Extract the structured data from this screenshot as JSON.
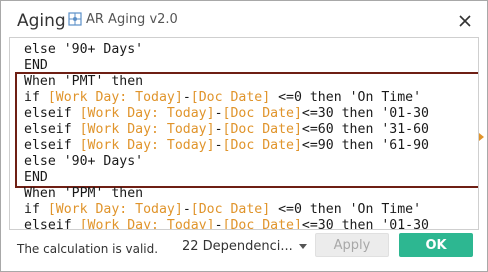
{
  "dialog": {
    "title": "Aging",
    "datasource_icon": "datasource-icon",
    "datasource_label": "AR Aging v2.0",
    "close_icon": "close-icon"
  },
  "code": {
    "lines": [
      [
        {
          "t": "else '90+ Days'",
          "c": "kw"
        }
      ],
      [
        {
          "t": "END",
          "c": "kw"
        }
      ],
      [
        {
          "t": "When 'PMT' then",
          "c": "kw"
        }
      ],
      [
        {
          "t": "if ",
          "c": "kw"
        },
        {
          "t": "[Work Day: Today]",
          "c": "fld"
        },
        {
          "t": "-",
          "c": "kw"
        },
        {
          "t": "[Doc Date]",
          "c": "fld"
        },
        {
          "t": " <=0 then 'On Time'",
          "c": "kw"
        }
      ],
      [
        {
          "t": "elseif ",
          "c": "kw"
        },
        {
          "t": "[Work Day: Today]",
          "c": "fld"
        },
        {
          "t": "-",
          "c": "kw"
        },
        {
          "t": "[Doc Date]",
          "c": "fld"
        },
        {
          "t": "<=30 then '01-30",
          "c": "kw"
        }
      ],
      [
        {
          "t": "elseif ",
          "c": "kw"
        },
        {
          "t": "[Work Day: Today]",
          "c": "fld"
        },
        {
          "t": "-",
          "c": "kw"
        },
        {
          "t": "[Doc Date]",
          "c": "fld"
        },
        {
          "t": "<=60 then '31-60",
          "c": "kw"
        }
      ],
      [
        {
          "t": "elseif ",
          "c": "kw"
        },
        {
          "t": "[Work Day: Today]",
          "c": "fld"
        },
        {
          "t": "-",
          "c": "kw"
        },
        {
          "t": "[Doc Date]",
          "c": "fld"
        },
        {
          "t": "<=90 then '61-90",
          "c": "kw"
        }
      ],
      [
        {
          "t": "else '90+ Days'",
          "c": "kw"
        }
      ],
      [
        {
          "t": "END",
          "c": "kw"
        }
      ],
      [
        {
          "t": "When 'PPM' then",
          "c": "kw"
        }
      ],
      [
        {
          "t": "if ",
          "c": "kw"
        },
        {
          "t": "[Work Day: Today]",
          "c": "fld"
        },
        {
          "t": "-",
          "c": "kw"
        },
        {
          "t": "[Doc Date]",
          "c": "fld"
        },
        {
          "t": " <=0 then 'On Time'",
          "c": "kw"
        }
      ],
      [
        {
          "t": "elseif ",
          "c": "kw"
        },
        {
          "t": "[Work Day: Today]",
          "c": "fld"
        },
        {
          "t": "-",
          "c": "kw"
        },
        {
          "t": "[Doc Date]",
          "c": "fld"
        },
        {
          "t": "<=30 then '01-30",
          "c": "kw"
        }
      ]
    ]
  },
  "footer": {
    "status": "The calculation is valid.",
    "dependencies": "22 Dependenci...",
    "apply_label": "Apply",
    "ok_label": "OK"
  },
  "colors": {
    "field": "#e0942b",
    "highlight_border": "#6e1f14",
    "ok_button": "#2db791"
  }
}
